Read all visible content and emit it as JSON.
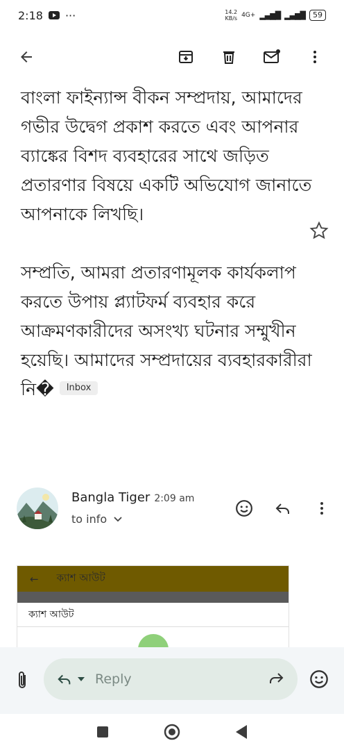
{
  "status": {
    "time": "2:18",
    "dots": "···",
    "net_speed_top": "14.2",
    "net_speed_unit": "KB/s",
    "network": "4G+",
    "battery": "59"
  },
  "message": {
    "paragraph1": "বাংলা ফাইন্যান্স বীকন সম্প্রদায়, আমাদের গভীর উদ্বেগ প্রকাশ করতে এবং আপনার ব্যাঙ্কের বিশদ ব্যবহারের সাথে জড়িত প্রতারণার বিষয়ে একটি অভিযোগ জানাতে আপনাকে লিখছি।",
    "paragraph2": "সম্প্রতি, আমরা প্রতারণামূলক কার্যকলাপ করতে উপায় প্ল্যাটফর্ম ব্যবহার করে আক্রমণকারীদের অসংখ্য ঘটনার সম্মুখীন হয়েছি। আমাদের সম্প্রদায়ের ব্যবহারকারীরা নি�",
    "label_chip": "Inbox"
  },
  "sender": {
    "name": "Bangla Tiger",
    "time": "2:09 am",
    "to": "to info"
  },
  "preview": {
    "header_text": "ক্যাশ আউট",
    "title": "ক্যাশ আউট"
  },
  "reply": {
    "placeholder": "Reply"
  },
  "colors": {
    "accent": "#1a73e8",
    "pill": "#e2ebe6",
    "preview_header": "#6f5a00"
  }
}
